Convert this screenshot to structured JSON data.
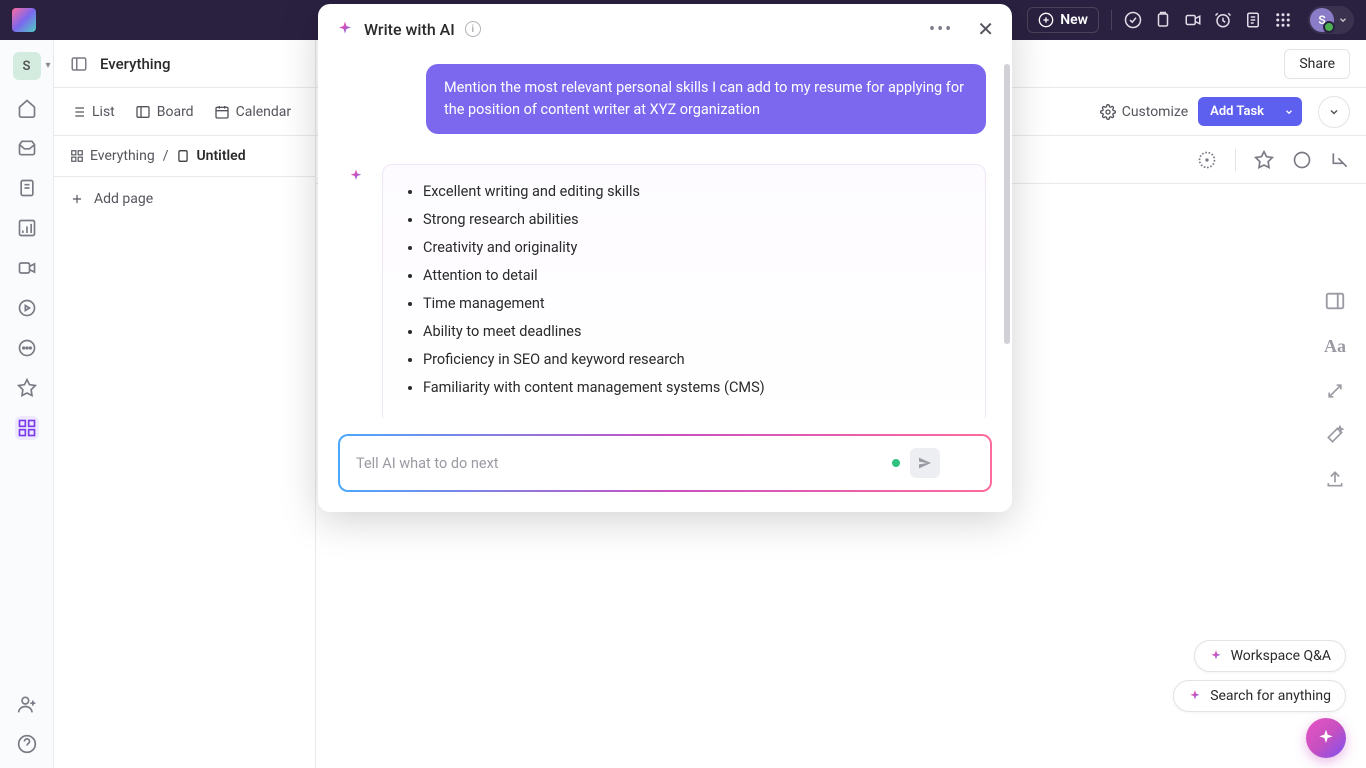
{
  "topbar": {
    "new_label": "New",
    "avatar_initial": "S"
  },
  "rail": {
    "workspace_initial": "S"
  },
  "sidebar": {
    "title": "Everything",
    "views": {
      "list": "List",
      "board": "Board",
      "calendar": "Calendar"
    },
    "breadcrumb": {
      "root": "Everything",
      "sep": "/",
      "current": "Untitled"
    },
    "add_page": "Add page"
  },
  "main": {
    "share": "Share",
    "customize": "Customize",
    "add_task": "Add Task"
  },
  "pills": {
    "qa": "Workspace Q&A",
    "search": "Search for anything"
  },
  "ai": {
    "title": "Write with AI",
    "user_message": "Mention the most relevant personal skills I can add to my resume for applying for the position of content writer at XYZ organization",
    "skills": [
      "Excellent writing and editing skills",
      "Strong research abilities",
      "Creativity and originality",
      "Attention to detail",
      "Time management",
      "Ability to meet deadlines",
      "Proficiency in SEO and keyword research",
      "Familiarity with content management systems (CMS)"
    ],
    "input_placeholder": "Tell AI what to do next"
  },
  "colors": {
    "accent": "#7b68ee",
    "primary_btn": "#5d5fef",
    "fab_grad_a": "#e754c4",
    "fab_grad_b": "#7b4ff0"
  }
}
